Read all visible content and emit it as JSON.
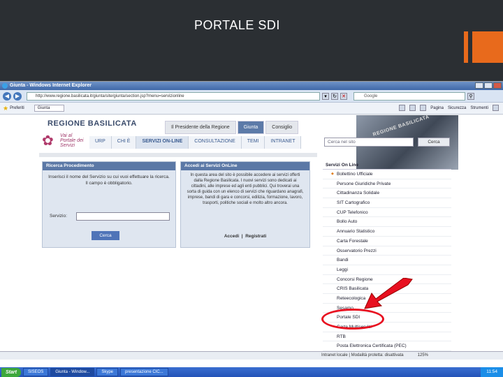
{
  "slide": {
    "title": "PORTALE SDI",
    "accent_color": "#e86a1c"
  },
  "browser": {
    "window_title": "Giunta - Windows Internet Explorer",
    "url": "http://www.regione.basilicata.it/giunta/site/giunta/section.jsp?menu=servizionline",
    "search_placeholder": "Google",
    "favorites_label": "Preferiti",
    "tab_label": "Giunta",
    "cmd_pagina": "Pagina",
    "cmd_sicurezza": "Sicurezza",
    "cmd_strumenti": "Strumenti"
  },
  "site": {
    "logo_text": "REGIONE BASILICATA",
    "portal_text": "Vai al Portale dei Servizi",
    "top_tabs": [
      "Il Presidente della Regione",
      "Giunta",
      "Consiglio"
    ],
    "nav": [
      "URP",
      "CHI È",
      "SERVIZI ON-LINE",
      "CONSULTAZIONE",
      "TEMI",
      "INTRANET"
    ],
    "banner_sign": "REGIONE BASILICATA"
  },
  "ricerca": {
    "title": "Ricerca Procedimento",
    "text": "Inserisci il nome del Servizio su cui vuoi effettuare la ricerca. Il campo è obbligatorio.",
    "field_label": "Servizio:",
    "button": "Cerca"
  },
  "accedi": {
    "title": "Accedi ai Servizi OnLine",
    "text": "In questa area del sito è possibile accedere ai servizi offerti dalla Regione Basilicata. I nuovi servizi sono dedicati ai cittadini, alle imprese ed agli enti pubblici. Qui troverai una sorta di guida con un elenco di servizi che riguardano anagrafi, imprese, bandi di gara e concorsi, edilizia, formazione, lavoro, trasporti, politiche sociali e molto altro ancora.",
    "link_accedi": "Accedi",
    "link_registrati": "Registrati"
  },
  "sidebar": {
    "search_placeholder": "Cerca nel sito",
    "search_button": "Cerca",
    "heading": "Servizi On Line",
    "items": [
      "Bollettino Ufficiale",
      "Persone Giuridiche Private",
      "Cittadinanza Solidale",
      "SIT Cartografico",
      "CUP Telefonico",
      "Bollo Auto",
      "Annuario Statistico",
      "Carta Forestale",
      "Osservatorio Prezzi",
      "Bandi",
      "Leggi",
      "Concorsi Regione",
      "CRIS Basilicata",
      "Reteecologica",
      "Sesamo",
      "Portale SDI",
      "Carta Multiservizi",
      "RTB",
      "Posta Elettronica Certificata (PEC)"
    ]
  },
  "status": {
    "text": "Intranet locale | Modalità protetta: disattivata",
    "zoom": "125%"
  },
  "taskbar": {
    "start": "Start",
    "items": [
      "SISEOS",
      "Giunta - Window...",
      "Skype",
      "presentazione CIC..."
    ],
    "clock": "11:54"
  },
  "annotation": {
    "highlight_color": "#e81020"
  }
}
